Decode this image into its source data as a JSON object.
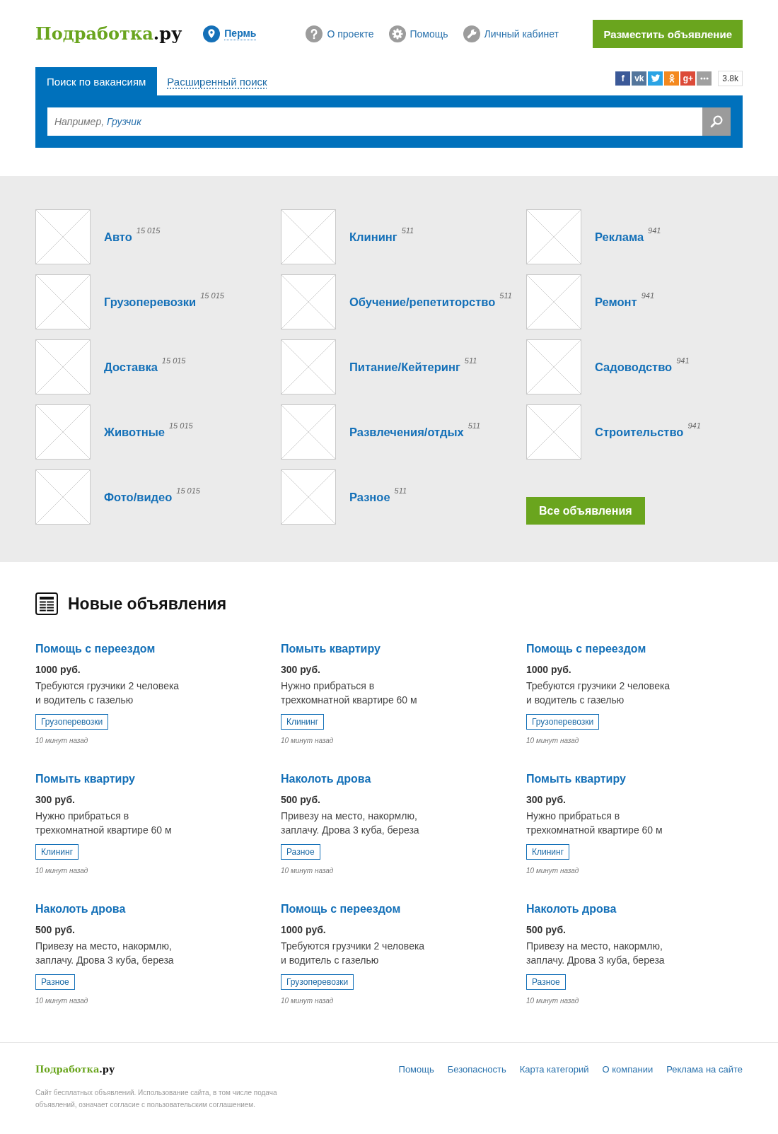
{
  "header": {
    "logo": {
      "name": "Подработка",
      "domain": ".ру"
    },
    "city": "Пермь",
    "nav": [
      "О проекте",
      "Помощь",
      "Личный кабинет"
    ],
    "post_button": "Разместить объявление"
  },
  "search": {
    "tabs": [
      {
        "label": "Поиск по вакансиям",
        "selected": true
      },
      {
        "label": "Расширенный поиск",
        "selected": false
      }
    ],
    "social": [
      {
        "text": "f",
        "color": "#3b5998"
      },
      {
        "text": "vk",
        "color": "#54769c"
      },
      {
        "color": "#2ba3e4"
      },
      {
        "color": "#f4891f"
      },
      {
        "text": "g+",
        "color": "#dc4a38"
      },
      {
        "color": "#a0a0a0"
      }
    ],
    "share_count": "3.8k",
    "placeholder": "Например,",
    "placeholder_example": "Грузчик"
  },
  "categories": {
    "columns": [
      [
        {
          "name": "Авто",
          "count": "15 015"
        },
        {
          "name": "Грузоперевозки",
          "count": "15 015"
        },
        {
          "name": "Доставка",
          "count": "15 015"
        },
        {
          "name": "Животные",
          "count": "15 015"
        },
        {
          "name": "Фото/видео",
          "count": "15 015"
        }
      ],
      [
        {
          "name": "Клининг",
          "count": "511"
        },
        {
          "name": "Обучение/репетиторство",
          "count": "511"
        },
        {
          "name": "Питание/Кейтеринг",
          "count": "511"
        },
        {
          "name": "Развлечения/отдых",
          "count": "511"
        },
        {
          "name": "Разное",
          "count": "511"
        }
      ],
      [
        {
          "name": "Реклама",
          "count": "941"
        },
        {
          "name": "Ремонт",
          "count": "941"
        },
        {
          "name": "Садоводство",
          "count": "941"
        },
        {
          "name": "Строительство",
          "count": "941"
        }
      ]
    ],
    "all_button": "Все объявления"
  },
  "new_ads": {
    "title": "Новые объявления",
    "ads": [
      {
        "title": "Помощь с переездом",
        "price": "1000 руб.",
        "description": "Требуются грузчики 2 человека\nи водитель с газелью",
        "tag": "Грузоперевозки",
        "time": "10 минут назад"
      },
      {
        "title": "Помыть квартиру",
        "price": "300 руб.",
        "description": "Нужно прибраться в\nтрехкомнатной квартире 60 м",
        "tag": "Клининг",
        "time": "10 минут назад"
      },
      {
        "title": "Помощь с переездом",
        "price": "1000 руб.",
        "description": "Требуются грузчики 2 человека\nи водитель с газелью",
        "tag": "Грузоперевозки",
        "time": "10 минут назад"
      },
      {
        "title": "Помыть квартиру",
        "price": "300 руб.",
        "description": "Нужно прибраться в\nтрехкомнатной квартире 60 м",
        "tag": "Клининг",
        "time": "10 минут назад"
      },
      {
        "title": "Наколоть дрова",
        "price": "500 руб.",
        "description": "Привезу на место, накормлю,\nзаплачу. Дрова 3 куба, береза",
        "tag": "Разное",
        "time": "10 минут назад"
      },
      {
        "title": "Помыть квартиру",
        "price": "300 руб.",
        "description": "Нужно прибраться в\nтрехкомнатной квартире 60 м",
        "tag": "Клининг",
        "time": "10 минут назад"
      },
      {
        "title": "Наколоть дрова",
        "price": "500 руб.",
        "description": "Привезу на место, накормлю,\nзаплачу. Дрова 3 куба, береза",
        "tag": "Разное",
        "time": "10 минут назад"
      },
      {
        "title": "Помощь с переездом",
        "price": "1000 руб.",
        "description": "Требуются грузчики 2 человека\nи водитель с газелью",
        "tag": "Грузоперевозки",
        "time": "10 минут назад"
      },
      {
        "title": "Наколоть дрова",
        "price": "500 руб.",
        "description": "Привезу на место, накормлю,\nзаплачу. Дрова 3 куба, береза",
        "tag": "Разное",
        "time": "10 минут назад"
      }
    ]
  },
  "footer": {
    "logo": {
      "name": "Подработка",
      "domain": ".ру"
    },
    "note": "Сайт бесплатных объявлений. Использование сайта, в том числе подача\nобъявлений, означает согласие с пользовательским соглашением.",
    "links": [
      "Помощь",
      "Безопасность",
      "Карта категорий",
      "О компании",
      "Реклама на сайте"
    ]
  }
}
